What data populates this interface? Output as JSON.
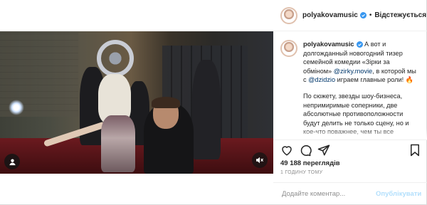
{
  "post": {
    "username": "polyakovamusic",
    "follow_label": "Відстежується",
    "separator": "•",
    "caption": {
      "username": "polyakovamusic",
      "text_1": " А вот и долгожданный новогодний тизер семейной комедии «Зірки за обміном» ",
      "mention_1": "@zirky.movie",
      "text_2": ", в которой мы с ",
      "mention_2": "@dzidzio",
      "text_3": " играем главные роли! 🔥",
      "paragraph_2": "По сюжету, звезды шоу-бизнеса, непримиримые соперники, две абсолютные противоположности будут делить не только сцену, но и кое-что поважнее, чем ты все"
    },
    "views": "49 188 переглядів",
    "time": "1 ГОДИНУ ТОМУ",
    "comment_placeholder": "Додайте коментар...",
    "publish_label": "Опублікувати"
  },
  "icons": {
    "verified": "verified-badge-icon",
    "like": "heart-icon",
    "comment": "comment-icon",
    "share": "paper-plane-icon",
    "save": "bookmark-icon",
    "mute": "speaker-muted-icon",
    "user_tag": "user-tag-icon"
  },
  "colors": {
    "accent": "#0095f6",
    "publish_disabled": "#b2dffc",
    "mention": "#00376b",
    "muted_text": "#8e8e8e"
  }
}
